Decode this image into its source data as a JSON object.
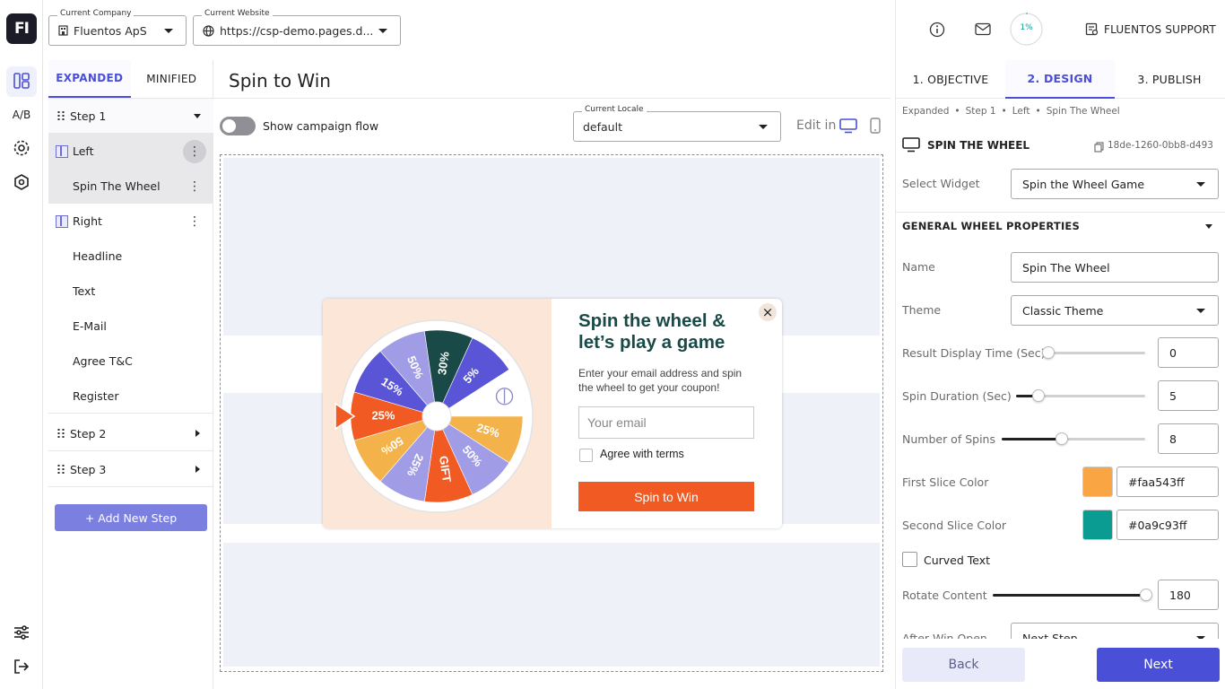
{
  "app": {
    "logo": "FI"
  },
  "rail": {
    "ab_label": "A/B"
  },
  "header": {
    "company_label": "Current Company",
    "company_value": "Fluentos ApS",
    "website_label": "Current Website",
    "website_value": "https://csp-demo.pages.d...",
    "progress_text": "1%",
    "progress_value": 0.01,
    "support_label": "FLUENTOS SUPPORT"
  },
  "tree": {
    "tabs": [
      "EXPANDED",
      "MINIFIED"
    ],
    "items": [
      {
        "label": "Step 1"
      },
      {
        "label": "Left"
      },
      {
        "label": "Spin The Wheel"
      },
      {
        "label": "Right"
      },
      {
        "label": "Headline"
      },
      {
        "label": "Text"
      },
      {
        "label": "E-Mail"
      },
      {
        "label": "Agree T&C"
      },
      {
        "label": "Register"
      },
      {
        "label": "Step 2"
      },
      {
        "label": "Step 3"
      }
    ],
    "add_step": "+ Add New Step"
  },
  "canvas": {
    "title": "Spin to Win",
    "flow_toggle_label": "Show campaign flow",
    "flow_toggle_on": false,
    "locale_label": "Current Locale",
    "locale_value": "default",
    "edit_in_label": "Edit in"
  },
  "popup": {
    "headline_line1": "Spin the wheel &",
    "headline_line2": "let’s play a game",
    "text_line1": "Enter your email address and spin",
    "text_line2": "the wheel to get your coupon!",
    "email_placeholder": "Your email",
    "agree_label": "Agree with terms",
    "cta": "Spin to Win",
    "close_glyph": "×",
    "wheel_slices": [
      {
        "label": "25%",
        "color": "#f15a22"
      },
      {
        "label": "15%",
        "color": "#5a55d6"
      },
      {
        "label": "50%",
        "color": "#a09ce6"
      },
      {
        "label": "30%",
        "color": "#1a4a47"
      },
      {
        "label": "5%",
        "color": "#5a55d6"
      },
      {
        "label": "",
        "color": "#ffffff"
      },
      {
        "label": "25%",
        "color": "#f4b24a"
      },
      {
        "label": "50%",
        "color": "#a09ce6"
      },
      {
        "label": "GIFT",
        "color": "#f15a22"
      },
      {
        "label": "25%",
        "color": "#a09ce6"
      },
      {
        "label": "50%",
        "color": "#f4b24a"
      }
    ]
  },
  "panel": {
    "tabs": [
      "1. OBJECTIVE",
      "2. DESIGN",
      "3. PUBLISH"
    ],
    "breadcrumb": [
      "Expanded",
      "Step 1",
      "Left",
      "Spin The Wheel"
    ],
    "widget_title": "SPIN THE WHEEL",
    "widget_id": "18de-1260-0bb8-d493",
    "select_widget_label": "Select Widget",
    "select_widget_value": "Spin the Wheel Game",
    "section_title": "GENERAL WHEEL PROPERTIES",
    "name_label": "Name",
    "name_value": "Spin The Wheel",
    "theme_label": "Theme",
    "theme_value": "Classic Theme",
    "result_time_label": "Result Display Time (Sec)",
    "result_time_value": "0",
    "spin_duration_label": "Spin Duration (Sec)",
    "spin_duration_value": "5",
    "spins_label": "Number of Spins",
    "spins_value": "8",
    "first_color_label": "First Slice Color",
    "first_color_value": "#faa543ff",
    "first_color": "#faa543",
    "second_color_label": "Second Slice Color",
    "second_color_value": "#0a9c93ff",
    "second_color": "#0a9c93",
    "curved_text_label": "Curved Text",
    "rotate_label": "Rotate Content",
    "rotate_value": "180",
    "after_win_label": "After Win Open",
    "after_win_value": "Next Step",
    "back_button": "Back",
    "next_button": "Next"
  },
  "colors": {
    "accent": "#4a4fd8",
    "cta": "#f15a22",
    "headline": "#1a4a47"
  }
}
